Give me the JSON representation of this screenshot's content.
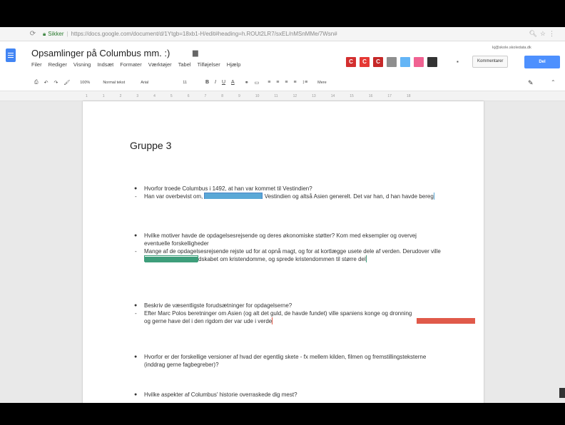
{
  "browser": {
    "secure_label": "Sikker",
    "url": "https://docs.google.com/document/d/1Ytgb=18xb1-H/edit#heading=h.ROUt2LR7/sxEL/nMSnMMe/7Wsn#"
  },
  "doc": {
    "title": "Opsamlinger på Columbus mm. :)",
    "menu": [
      "Filer",
      "Rediger",
      "Visning",
      "Indsæt",
      "Formater",
      "Værktøjer",
      "Tabel",
      "Tilføjelser",
      "Hjælp"
    ],
    "user_email": "kj@skole.skoledata.dk",
    "comment_label": "Kommentarer",
    "share_label": "Del"
  },
  "collaborators": [
    {
      "letter": "C",
      "color": "#d32f2f"
    },
    {
      "letter": "C",
      "color": "#e53935"
    },
    {
      "letter": "C",
      "color": "#c62828"
    },
    {
      "letter": "",
      "color": "#8e8e8e"
    },
    {
      "letter": "",
      "color": "#64b5f6"
    },
    {
      "letter": "",
      "color": "#f06292"
    },
    {
      "letter": "",
      "color": "#333333"
    }
  ],
  "toolbar": {
    "zoom": "100%",
    "style": "Normal tekst",
    "font": "Arial",
    "size": "11",
    "more": "Mere"
  },
  "ruler": [
    "1",
    "1",
    "2",
    "3",
    "4",
    "5",
    "6",
    "7",
    "8",
    "9",
    "10",
    "11",
    "12",
    "13",
    "14",
    "15",
    "16",
    "17",
    "18"
  ],
  "content": {
    "heading": "Gruppe 3",
    "questions": [
      {
        "q": "Hvorfor troede Columbus i 1492, at han var kommet til Vestindien?",
        "a1": "Han var overbevist om, ",
        "a2": " Vestindien og altså Asien generelt. Det var han, d han havde bereg",
        "tag_color": "#5aa8d6"
      },
      {
        "q": "Hvilke motiver havde de opdagelsesrejsende og deres økonomiske støtter? Kom med eksempler og overvej eventuelle forskelligheder",
        "a1": "Mange af de opdagelsesrejsende rejste ud for at opnå magt, og for at kortlægge usete dele af verden. Derudover ville ",
        "a2": "dskabet om kristendomme, og sprede kristendommen til større del",
        "tag_color": "#3e9e7b"
      },
      {
        "q": "Beskriv de væsentligste forudsætninger for opdagelserne?",
        "a": "Efter Marc Polos beretninger om Asien (og alt det guld, de havde fundet) ville spaniens konge og dronning og gerne have del i den rigdom der var ude i verde",
        "tag_color": "#e05a4a"
      },
      {
        "q": "Hvorfor er der forskellige versioner af hvad der egentlig skete - fx mellem kilden, filmen og fremstillingsteksterne (inddrag gerne fagbegreber)?"
      },
      {
        "q": "Hvilke aspekter af Columbus' historie overraskede dig mest?"
      }
    ]
  }
}
